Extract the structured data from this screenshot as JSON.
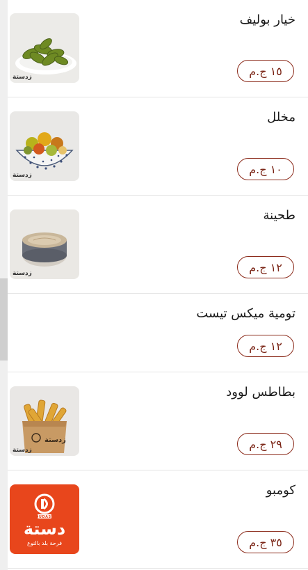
{
  "items": [
    {
      "name": "خيار بوليف",
      "price": "١٥ ج.م",
      "image_icon": "pickles-photo",
      "watermark": "زدستة"
    },
    {
      "name": "مخلل",
      "price": "١٠ ج.م",
      "image_icon": "mixed-pickles-photo",
      "watermark": "زدستة"
    },
    {
      "name": "طحينة",
      "price": "١٢ ج.م",
      "image_icon": "tahini-photo",
      "watermark": "زدستة"
    },
    {
      "name": "تومية ميكس تيست",
      "price": "١٢ ج.م"
    },
    {
      "name": "بطاطس لوود",
      "price": "٢٩ ج.م",
      "image_icon": "fries-photo",
      "watermark": "زدستة"
    },
    {
      "name": "كومبو",
      "price": "٣٥ ج.م",
      "image_icon": "dasta-logo",
      "logo_text": "دستة",
      "logo_subtext": "فرحة بلد بالنوع",
      "logo_badge": "NOUDASTA"
    }
  ],
  "colors": {
    "accent": "#8b2a1a",
    "logo_bg": "#e8461c"
  }
}
